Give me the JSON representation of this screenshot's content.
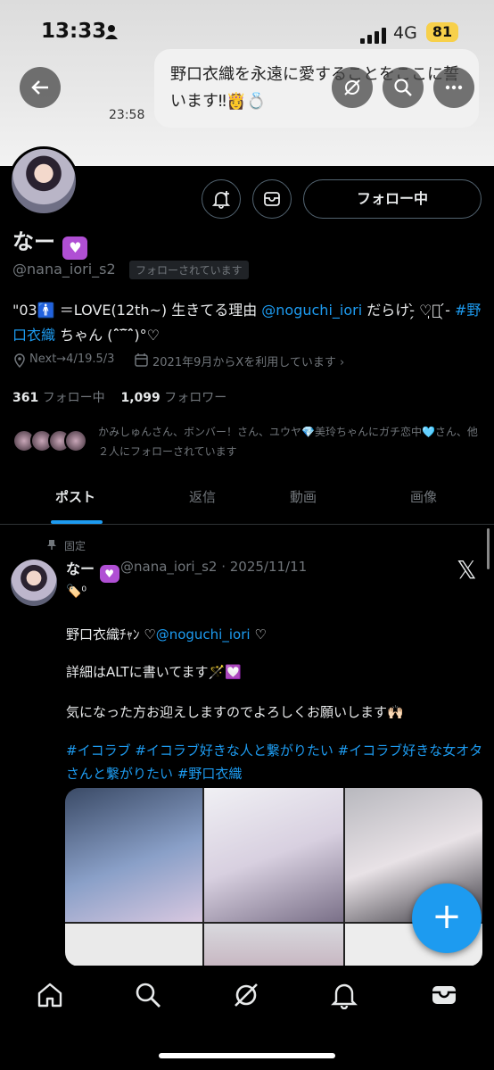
{
  "status_bar": {
    "time": "13:33",
    "network": "4G",
    "battery": "81"
  },
  "notification": {
    "message": "野口衣織を永遠に愛することをここに誓います‼︎👸💍",
    "time": "23:58"
  },
  "profile": {
    "name": "なー",
    "handle": "@nana_iori_s2",
    "follows_you": "フォローされています",
    "bio_pre": "\"03🚹 ＝LOVE(12th~) 生きてる理由 ",
    "bio_mention": "@noguchi_iori",
    "bio_mid": " だらけ-̗̀ ♡̩͙ ̖́- ",
    "bio_tag": "#野口衣織",
    "bio_post": " ちゃん (ˆ̑‾̑ˆ̑)°♡",
    "location": "Next→4/19.5/3",
    "joined": "2021年9月からXを利用しています",
    "following_count": "361",
    "following_label": "フォロー中",
    "followers_count": "1,099",
    "followers_label": "フォロワー",
    "followed_by": "かみしゅんさん、ボンバー！さん、ユウヤ💎美玲ちゃんにガチ恋中🩵さん、他２人にフォローされています",
    "follow_button": "フォロー中"
  },
  "tabs": [
    "ポスト",
    "返信",
    "動画",
    "画像"
  ],
  "post": {
    "pinned_label": "固定",
    "name": "なー",
    "handle_date": "@nana_iori_s2 · 2025/11/11",
    "tag_line": "🏷️⁰",
    "line1_pre": "野口衣織ﾁｬﾝ ♡",
    "line1_mention": "@noguchi_iori",
    "line1_post": " ♡",
    "line2": "詳細はALTに書いてます🪄💟",
    "line3": "気になった方お迎えしますのでよろしくお願いします🙌🏻",
    "hashtags": "#イコラブ  #イコラブ好きな人と繋がりたい  #イコラブ好きな女オタさんと繋がりたい  #野口衣織"
  },
  "fab_label": "+",
  "icons": [
    "back-arrow-icon",
    "grok-icon",
    "search-icon",
    "more-icon",
    "bell-plus-icon",
    "mail-icon",
    "location-icon",
    "calendar-icon",
    "pin-icon",
    "x-logo-icon",
    "home-icon",
    "search-icon",
    "grok-icon",
    "notifications-icon",
    "messages-icon"
  ],
  "colors": {
    "accent": "#1d9bf0",
    "background": "#000000",
    "heart": "#b04fd4",
    "battery": "#f7d04a"
  }
}
